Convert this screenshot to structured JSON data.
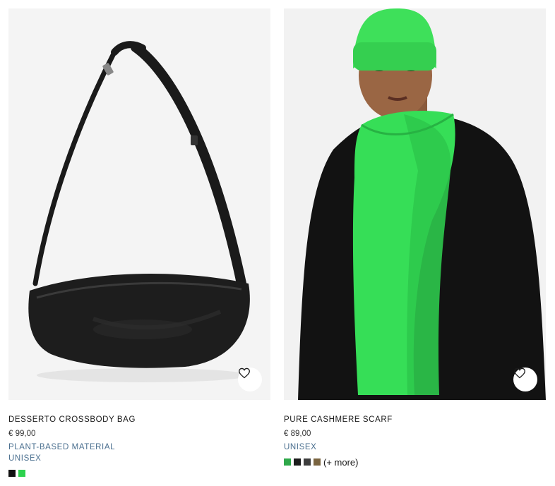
{
  "products": [
    {
      "name": "DESSERTO CROSSBODY BAG",
      "price": "€ 99,00",
      "tags": [
        "PLANT-BASED MATERIAL",
        "UNISEX"
      ],
      "swatch_colors": [
        "#111111",
        "#2dd24e"
      ],
      "more_label": "",
      "image_name": "black crossbody bag",
      "wishlist_icon": "heart-icon"
    },
    {
      "name": "PURE CASHMERE SCARF",
      "price": "€ 89,00",
      "tags": [
        "UNISEX"
      ],
      "swatch_colors": [
        "#2fa84a",
        "#1c1c1c",
        "#3d3d3d",
        "#7a6440"
      ],
      "more_label": "(+ more)",
      "image_name": "model wearing green beanie and scarf",
      "wishlist_icon": "heart-icon"
    }
  ]
}
